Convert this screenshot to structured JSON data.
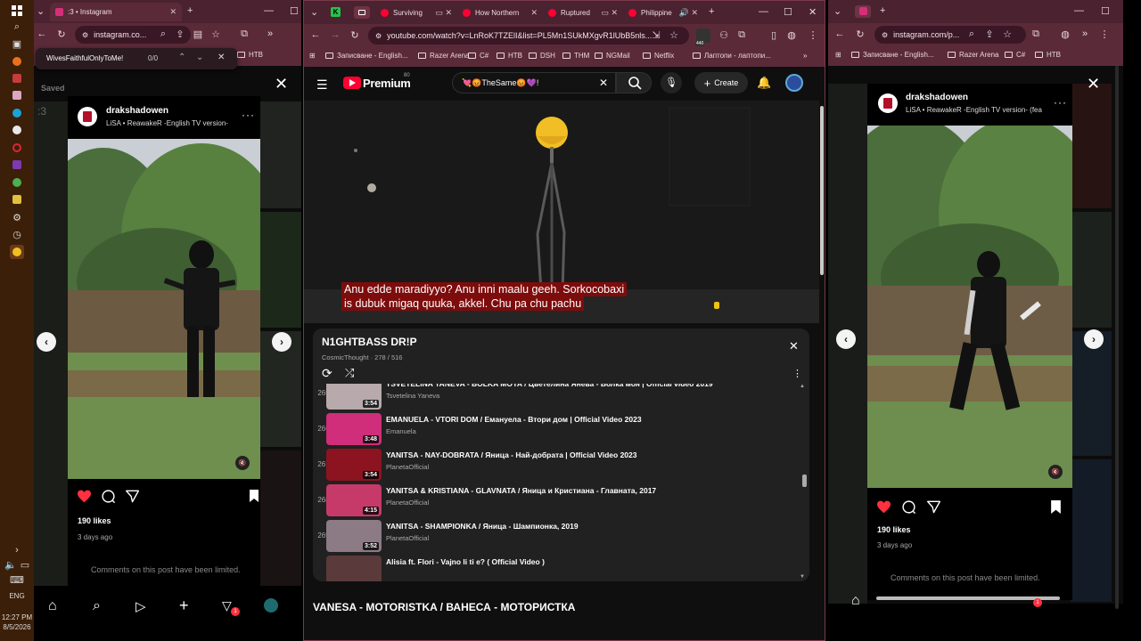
{
  "taskbar": {
    "clock": "12:27 PM",
    "date": "8/5/2026",
    "language": "ENG"
  },
  "left_window": {
    "tab": {
      "title": ":3 • Instagram",
      "close": "✕"
    },
    "new_tab": "+",
    "url": "instagram.co...",
    "findbar": {
      "query": "WivesFaithfulOnlyToMe!",
      "count": "0/0"
    },
    "bookmark": "НТВ",
    "bg_saved": "Saved",
    "bg_partial": ":3",
    "post": {
      "username": "drakshadowen",
      "subtitle": "LiSA • ReawakeR -English TV version-",
      "likes": "190 likes",
      "time_ago": "3 days ago",
      "comments_note": "Comments on this post have been limited."
    },
    "notification_count": "1"
  },
  "middle_window": {
    "tabs": [
      {
        "title": "Surviving",
        "active": false
      },
      {
        "title": "How Northern",
        "active": false
      },
      {
        "title": "Ruptured",
        "active": false
      },
      {
        "title": "Philippine",
        "active": false
      }
    ],
    "url": "youtube.com/watch?v=LnRoK7TZElI&list=PL5Mn1SUkMXgvR1lUbB5nls...",
    "extension_badge": "440",
    "bookmarks": [
      "Записване - English...",
      "Razer Arena",
      "C#",
      "НТВ",
      "DSH",
      "THM",
      "NGMail",
      "Netflix",
      "Лаптопи - лаптопи..."
    ],
    "youtube": {
      "logo_text": "Premium",
      "logo_badge": "80",
      "search_query": "💘😡TheSame😡💜!",
      "create_label": "Create",
      "subtitle_lines": [
        "Anu edde maradiyyo? Anu inni maalu geeh. Sorkocobaxi",
        "is dubuk migaq quuka, akkel. Chu pa chu pachu"
      ],
      "playlist": {
        "title": "N1GHTBASS DR!P",
        "meta": "CosmicThought · 278 / 516",
        "items": [
          {
            "index": "265",
            "title": "TSVETELINA YANEVA - BOLKA MOYA / Цветелина Янева - Болка моя | Official video 2019",
            "channel": "Tsvetelina Yaneva",
            "duration": "3:54",
            "thumb": "#b7a9ac"
          },
          {
            "index": "266",
            "title": "EMANUELA - VTORI DOM / Емануела - Втори дом | Official Video 2023",
            "channel": "Emanuela",
            "duration": "3:48",
            "thumb": "#d02d7a"
          },
          {
            "index": "267",
            "title": "YANITSA - NAY-DOBRATA / Яница - Най-добрата | Official Video 2023",
            "channel": "PlanetaOfficial",
            "duration": "3:54",
            "thumb": "#8c1420"
          },
          {
            "index": "268",
            "title": "YANITSA & KRISTIANA - GLAVNATA / Яница и Кристиана - Главната, 2017",
            "channel": "PlanetaOfficial",
            "duration": "4:15",
            "thumb": "#c63a6a"
          },
          {
            "index": "269",
            "title": "YANITSA - SHAMPIONKA / Яница - Шампионка, 2019",
            "channel": "PlanetaOfficial",
            "duration": "3:52",
            "thumb": "#8c7a84"
          },
          {
            "index": "",
            "title": "Alisia ft. Flori - Vajno li ti e? ( Official Video )",
            "channel": "",
            "duration": "",
            "thumb": "#5a3a3a"
          }
        ]
      },
      "now_playing_title": "VANESA - MOTORISTKA / ВАНЕСА - МОТОРИСТКА"
    }
  },
  "right_window": {
    "url": "instagram.com/p...",
    "bookmarks": [
      "Записване - English...",
      "Razer Arena",
      "C#",
      "НТВ"
    ],
    "post": {
      "username": "drakshadowen",
      "subtitle": "LiSA • ReawakeR -English TV version- (fea",
      "likes": "190 likes",
      "time_ago": "3 days ago",
      "comments_note": "Comments on this post have been limited."
    },
    "notification_count": "1"
  },
  "colors": {
    "chrome_tabbar": "#4b2230",
    "chrome_toolbar": "#5b2a39",
    "youtube_red": "#ff0033",
    "like_red": "#ff3040",
    "subtitle_bg": "#7d0c0c"
  }
}
